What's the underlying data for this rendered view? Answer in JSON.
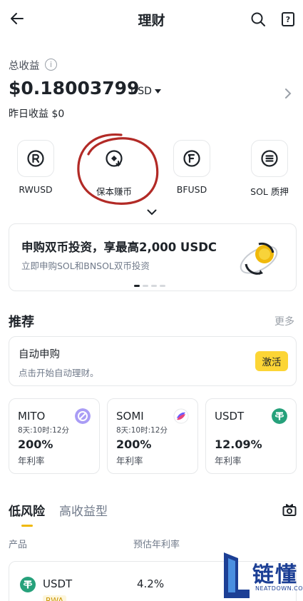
{
  "header": {
    "title": "理财"
  },
  "summary": {
    "total_label": "总收益",
    "total_value": "$0.18003799",
    "currency": "USD",
    "yesterday": "昨日收益 $0"
  },
  "quick_actions": [
    {
      "label": "RWUSD"
    },
    {
      "label": "保本赚币"
    },
    {
      "label": "BFUSD"
    },
    {
      "label": "SOL 质押"
    }
  ],
  "banner": {
    "title": "申购双币投资，享最高2,000 USDC",
    "subtitle": "立即申购SOL和BNSOL双币投资"
  },
  "recommend": {
    "title": "推荐",
    "more": "更多",
    "auto": {
      "title": "自动申购",
      "desc": "点击开始自动理财。",
      "button": "激活"
    }
  },
  "products": [
    {
      "name": "MITO",
      "time": "8天:10时:12分",
      "rate": "200%",
      "rate_label": "年利率",
      "color": "#8d7cf0"
    },
    {
      "name": "SOMI",
      "time": "8天:10时:12分",
      "rate": "200%",
      "rate_label": "年利率",
      "color": "#6a5cff"
    },
    {
      "name": "USDT",
      "time": "",
      "rate": "12.09%",
      "rate_label": "年利率",
      "color": "#26a17b"
    }
  ],
  "risk_tabs": {
    "low": "低风险",
    "high": "高收益型"
  },
  "table": {
    "col_product": "产品",
    "col_rate": "预估年利率",
    "row": {
      "name": "USDT",
      "rate": "4.2%",
      "tag": "RWA",
      "color": "#26a17b"
    }
  },
  "watermark": {
    "brand": "链懂",
    "site": "NEATDOWN.COM"
  }
}
